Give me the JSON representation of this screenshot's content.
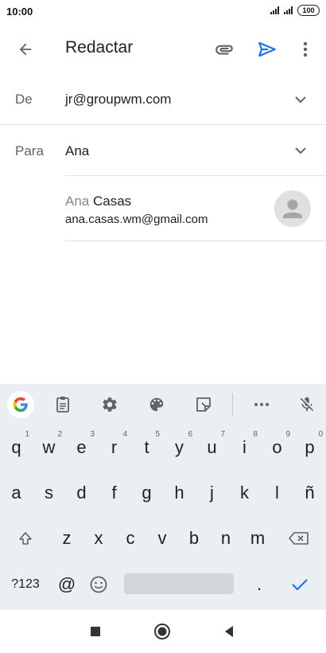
{
  "status_bar": {
    "time": "10:00",
    "battery": "100",
    "signal_icons": [
      "signal-icon",
      "signal-icon"
    ]
  },
  "app_bar": {
    "title": "Redactar",
    "icons": {
      "back": "arrow-back-icon",
      "attach": "paperclip-icon",
      "send": "send-icon",
      "more": "more-vert-icon"
    },
    "accent_color": "#1a73e8"
  },
  "from_field": {
    "label": "De",
    "value": "jr@groupwm.com"
  },
  "to_field": {
    "label": "Para",
    "value": "Ana"
  },
  "suggestion": {
    "name_match": "Ana",
    "name_rest": " Casas",
    "email": "ana.casas.wm@gmail.com"
  },
  "keyboard": {
    "toolbar_icons": [
      "google-icon",
      "clipboard-icon",
      "settings-icon",
      "palette-icon",
      "sticker-icon",
      "more-horiz-icon",
      "mic-off-icon"
    ],
    "row1": [
      {
        "key": "q",
        "hint": "1"
      },
      {
        "key": "w",
        "hint": "2"
      },
      {
        "key": "e",
        "hint": "3"
      },
      {
        "key": "r",
        "hint": "4"
      },
      {
        "key": "t",
        "hint": "5"
      },
      {
        "key": "y",
        "hint": "6"
      },
      {
        "key": "u",
        "hint": "7"
      },
      {
        "key": "i",
        "hint": "8"
      },
      {
        "key": "o",
        "hint": "9"
      },
      {
        "key": "p",
        "hint": "0"
      }
    ],
    "row2": [
      "a",
      "s",
      "d",
      "f",
      "g",
      "h",
      "j",
      "k",
      "l",
      "ñ"
    ],
    "row3": [
      "z",
      "x",
      "c",
      "v",
      "b",
      "n",
      "m"
    ],
    "symbols_key": "?123",
    "at_key": "@",
    "period_key": ".",
    "special_icons": {
      "shift": "shift-icon",
      "backspace": "backspace-icon",
      "emoji": "emoji-icon",
      "enter": "check-icon"
    }
  },
  "nav_bar": {
    "icons": [
      "recents-icon",
      "home-icon",
      "back-icon"
    ]
  }
}
